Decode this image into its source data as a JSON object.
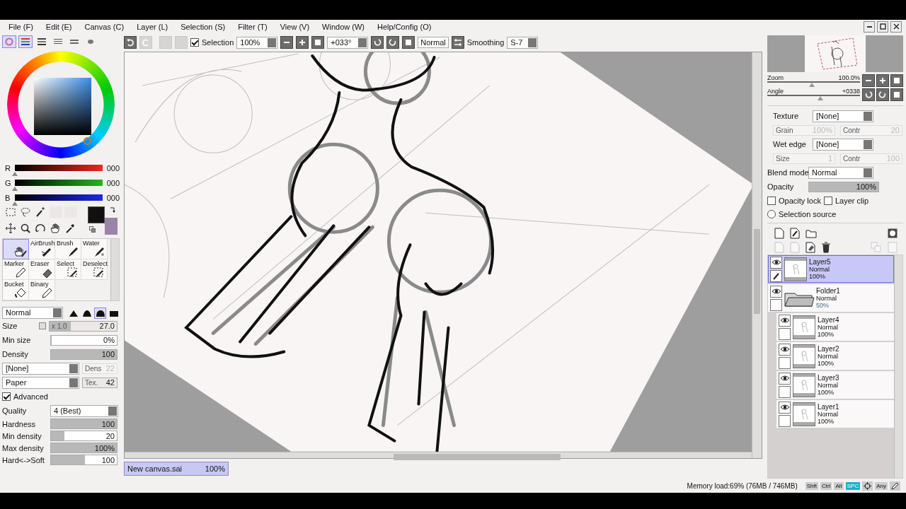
{
  "menu": [
    "File (F)",
    "Edit (E)",
    "Canvas (C)",
    "Layer (L)",
    "Selection (S)",
    "Filter (T)",
    "View (V)",
    "Window (W)",
    "Help/Config (O)"
  ],
  "color_tabs": [
    {
      "kind": "wheel",
      "selected": true
    },
    {
      "kind": "rgb",
      "selected": true
    },
    {
      "kind": "hsv",
      "selected": false
    },
    {
      "kind": "mixer",
      "selected": false
    },
    {
      "kind": "swatches",
      "selected": false
    },
    {
      "kind": "scratch",
      "selected": false
    }
  ],
  "rgb": [
    {
      "kind": "red",
      "label": "R",
      "value": "000",
      "level": 0
    },
    {
      "kind": "green",
      "label": "G",
      "value": "000",
      "level": 0
    },
    {
      "kind": "blue",
      "label": "B",
      "value": "000",
      "level": 0
    }
  ],
  "tools": [
    {
      "kind": "hand",
      "selected": true
    },
    {
      "kind": "airbrush",
      "label": "AirBrush",
      "selected": false
    },
    {
      "kind": "brush",
      "label": "Brush",
      "selected": false
    },
    {
      "kind": "water",
      "label": "Water",
      "selected": false
    },
    {
      "kind": "pencil",
      "label": "Marker",
      "selected": false
    },
    {
      "kind": "eraser",
      "label": "Eraser",
      "selected": false
    },
    {
      "kind": "select",
      "label": "Select",
      "selected": false
    },
    {
      "kind": "deselect",
      "label": "Deselect",
      "selected": false
    },
    {
      "kind": "bucket",
      "label": "Bucket",
      "selected": false
    },
    {
      "kind": "pencil",
      "label": "Binary",
      "selected": false
    }
  ],
  "brush": {
    "mode": "Normal",
    "tips": [
      {
        "selected": false
      },
      {
        "selected": false
      },
      {
        "selected": true
      },
      {
        "selected": false
      }
    ],
    "size": {
      "label": "Size",
      "multiplier": "x 1.0",
      "value": "27.0",
      "level": 0.32
    },
    "min_size": {
      "label": "Min size",
      "value": "0%",
      "level": 0
    },
    "density": {
      "label": "Density",
      "value": "100",
      "level": 1
    },
    "texture": "[None]",
    "texture_density": {
      "label": "Dens",
      "value": "22",
      "disabled": true
    },
    "paper": "Paper",
    "paper_tex": {
      "label": "Tex.",
      "value": "42",
      "disabled": false
    },
    "advanced": {
      "label": "Advanced",
      "checked": true
    },
    "quality": {
      "label": "Quality",
      "value": "4 (Best)"
    },
    "sliders": [
      {
        "label": "Hardness",
        "value": "100",
        "level": 1
      },
      {
        "label": "Min density",
        "value": "20",
        "level": 0.2
      },
      {
        "label": "Max density",
        "value": "100%",
        "level": 1
      },
      {
        "label": "Hard<->Soft",
        "value": "100",
        "level": 0.52
      }
    ]
  },
  "toolbar": {
    "selection": {
      "label": "Selection",
      "checked": true
    },
    "zoom": "100%",
    "angle": "+033°",
    "blend": "Normal",
    "smoothing_label": "Smoothing",
    "smoothing": "S-7"
  },
  "navigator": {
    "zoom": {
      "label": "Zoom",
      "value": "100.0%",
      "level": 0.48
    },
    "angle": {
      "label": "Angle",
      "value": "+0338",
      "level": 0.57
    }
  },
  "layer_props": {
    "texture": {
      "label": "Texture",
      "value": "[None]"
    },
    "texture_fields": [
      {
        "label": "Grain",
        "value": "100%",
        "disabled": true
      },
      {
        "label": "Contr",
        "value": "20",
        "disabled": true
      }
    ],
    "wet_edge": {
      "label": "Wet edge",
      "value": "[None]"
    },
    "wet_fields": [
      {
        "label": "Size",
        "value": "1",
        "disabled": true
      },
      {
        "label": "Contr",
        "value": "100",
        "disabled": true
      }
    ],
    "blend": {
      "label": "Blend mode",
      "value": "Normal"
    },
    "opacity": {
      "label": "Opacity",
      "value": "100%",
      "level": 1
    },
    "checks": [
      {
        "label": "Opacity lock",
        "checked": false
      },
      {
        "label": "Layer clip",
        "checked": false
      }
    ],
    "selection_source": {
      "label": "Selection source",
      "checked": false
    }
  },
  "layers": [
    {
      "kind": "layer",
      "name": "Layer5",
      "mode": "Normal",
      "opacity": "100%",
      "visible": true,
      "selected": true
    },
    {
      "kind": "folder",
      "name": "Folder1",
      "mode": "Normal",
      "opacity": "50%",
      "visible": true,
      "selected": false,
      "children": [
        {
          "kind": "layer",
          "name": "Layer4",
          "mode": "Normal",
          "opacity": "100%",
          "visible": true,
          "selected": false
        },
        {
          "kind": "layer",
          "name": "Layer2",
          "mode": "Normal",
          "opacity": "100%",
          "visible": true,
          "selected": false
        },
        {
          "kind": "layer",
          "name": "Layer3",
          "mode": "Normal",
          "opacity": "100%",
          "visible": true,
          "selected": false
        },
        {
          "kind": "layer",
          "name": "Layer1",
          "mode": "Normal",
          "opacity": "100%",
          "visible": true,
          "selected": false
        }
      ]
    }
  ],
  "canvas_tab": {
    "name": "New canvas.sai",
    "zoom": "100%",
    "selected": true
  },
  "status": {
    "memory": "Memory load:69% (76MB / 746MB)",
    "keys": [
      {
        "kind": "text",
        "label": "Shft",
        "on": false
      },
      {
        "kind": "text",
        "label": "Ctrl",
        "on": false
      },
      {
        "kind": "text",
        "label": "Alt",
        "on": false
      },
      {
        "kind": "text",
        "label": "SPC",
        "on": true
      },
      {
        "kind": "rotate",
        "on": false
      },
      {
        "kind": "text",
        "label": "Any",
        "on": false
      },
      {
        "kind": "pen",
        "on": false
      }
    ]
  }
}
